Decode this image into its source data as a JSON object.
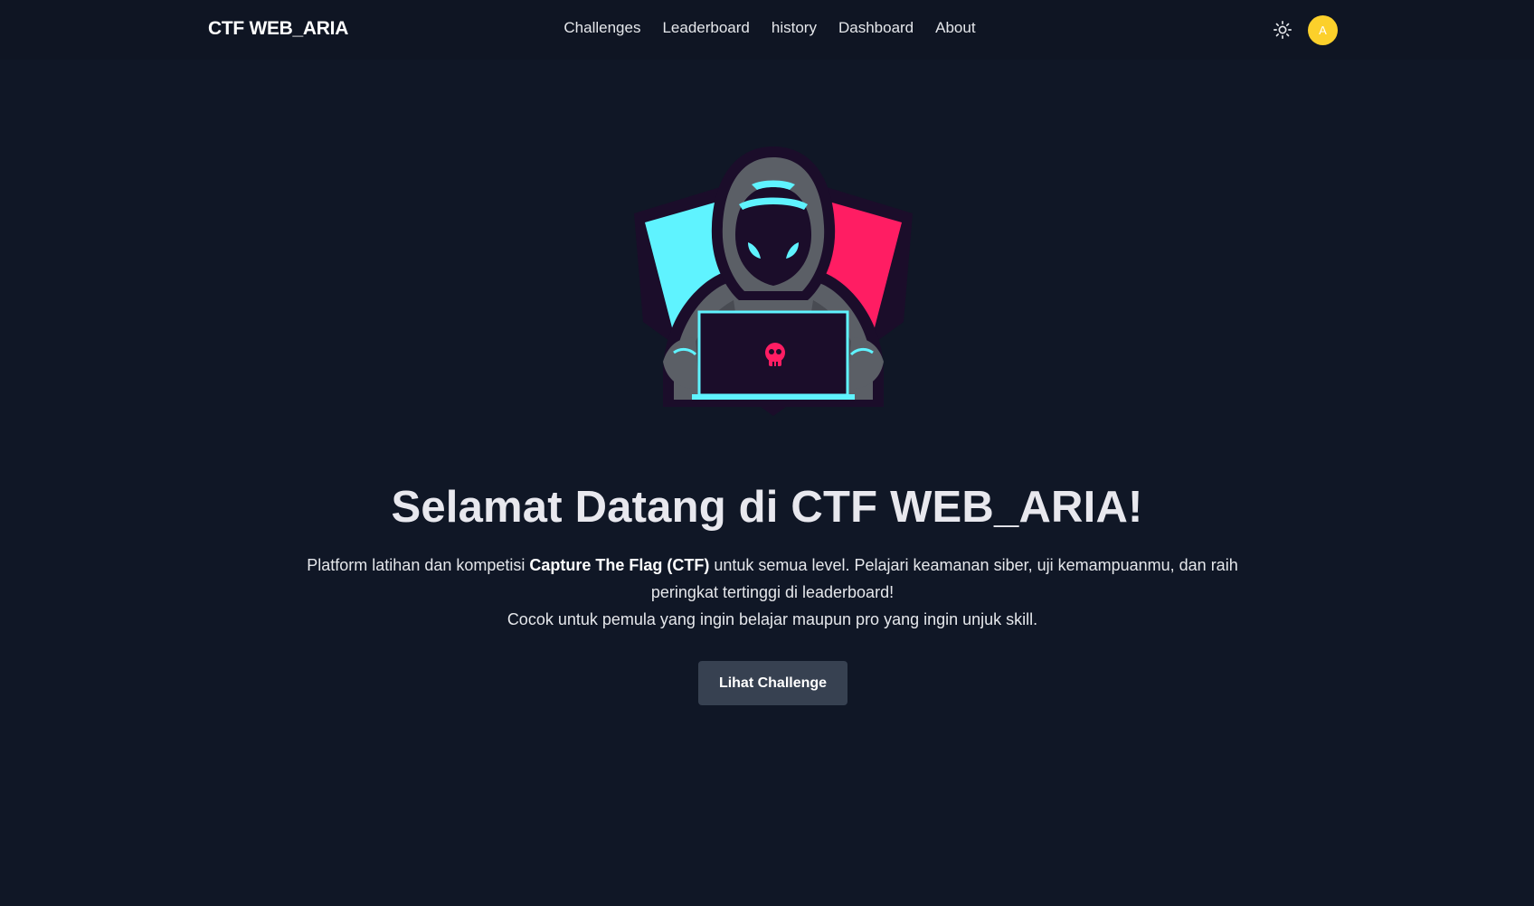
{
  "navbar": {
    "brand": "CTF WEB_ARIA",
    "links": [
      {
        "label": "Challenges"
      },
      {
        "label": "Leaderboard"
      },
      {
        "label": "history"
      },
      {
        "label": "Dashboard"
      },
      {
        "label": "About"
      }
    ],
    "theme_icon": "sun-icon",
    "avatar_initial": "A"
  },
  "hero": {
    "logo_icon": "hooded-hacker-laptop-logo",
    "title": "Selamat Datang di CTF WEB_ARIA!",
    "desc_part1": "Platform latihan dan kompetisi ",
    "desc_bold": "Capture The Flag (CTF)",
    "desc_part2": " untuk semua level. Pelajari keamanan siber, uji kemampuanmu, dan raih peringkat tertinggi di leaderboard!",
    "desc_line2": "Cocok untuk pemula yang ingin belajar maupun pro yang ingin unjuk skill.",
    "cta_label": "Lihat Challenge"
  },
  "colors": {
    "background": "#101726",
    "navbar": "#0f1523",
    "avatar": "#fcd02b",
    "button": "#374151",
    "logo_cyan": "#5ff3ff",
    "logo_pink": "#ff1d63"
  }
}
